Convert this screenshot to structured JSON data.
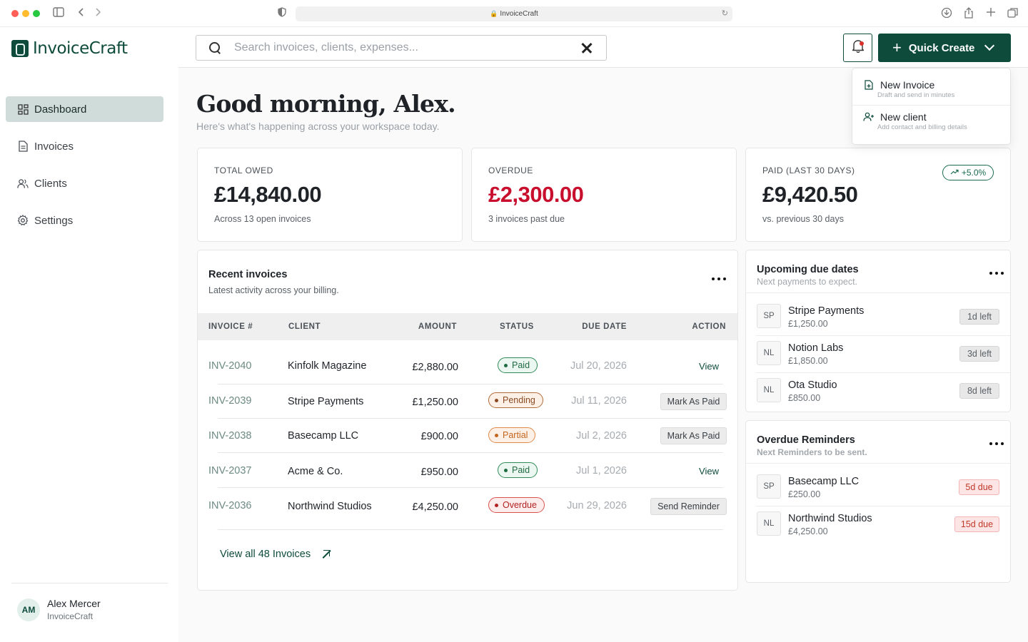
{
  "browser": {
    "url": "InvoiceCraft"
  },
  "app": {
    "name": "InvoiceCraft"
  },
  "sidebar": {
    "items": [
      {
        "label": "Dashboard",
        "icon": "dashboard-icon"
      },
      {
        "label": "Invoices",
        "icon": "document-icon"
      },
      {
        "label": "Clients",
        "icon": "users-icon"
      },
      {
        "label": "Settings",
        "icon": "gear-icon"
      }
    ],
    "active": "Dashboard",
    "user": {
      "initials": "AM",
      "name": "Alex Mercer",
      "org": "InvoiceCraft"
    }
  },
  "topbar": {
    "search_placeholder": "Search invoices, clients, expenses...",
    "search_value": "",
    "quick_create_label": "Quick Create"
  },
  "quick_create_menu": [
    {
      "title": "New Invoice",
      "subtitle": "Draft and send in minutes",
      "icon": "file-plus-icon"
    },
    {
      "title": "New client",
      "subtitle": "Add contact and billing details",
      "icon": "user-plus-icon"
    }
  ],
  "greeting": {
    "title": "Good morning, Alex.",
    "subtitle": "Here's what's happening across your workspace today."
  },
  "stats": [
    {
      "label": "TOTAL OWED",
      "value": "£14,840.00",
      "sub": "Across 13 open invoices"
    },
    {
      "label": "OVERDUE",
      "value": "£2,300.00",
      "sub": "3 invoices past due"
    },
    {
      "label": "PAID (LAST 30 DAYS)",
      "value": "£9,420.50",
      "sub": "vs. previous 30 days",
      "trend": "+5.0%"
    }
  ],
  "recent": {
    "title": "Recent invoices",
    "subtitle": "Latest activity across your billing.",
    "columns": [
      "INVOICE #",
      "CLIENT",
      "AMOUNT",
      "STATUS",
      "DUE DATE",
      "ACTION"
    ],
    "rows": [
      {
        "id": "INV-2040",
        "client": "Kinfolk Magazine",
        "amount": "£2,880.00",
        "status": "Paid",
        "due": "Jul 20, 2026",
        "action": "View"
      },
      {
        "id": "INV-2039",
        "client": "Stripe Payments",
        "amount": "£1,250.00",
        "status": "Pending",
        "due": "Jul 11, 2026",
        "action": "Mark As Paid"
      },
      {
        "id": "INV-2038",
        "client": "Basecamp LLC",
        "amount": "£900.00",
        "status": "Partial",
        "due": "Jul 2, 2026",
        "action": "Mark As Paid"
      },
      {
        "id": "INV-2037",
        "client": "Acme & Co.",
        "amount": "£950.00",
        "status": "Paid",
        "due": "Jul 1, 2026",
        "action": "View"
      },
      {
        "id": "INV-2036",
        "client": "Northwind Studios",
        "amount": "£4,250.00",
        "status": "Overdue",
        "due": "Jun 29, 2026",
        "action": "Send Reminder"
      }
    ],
    "view_all": "View all 48 Invoices"
  },
  "upcoming": {
    "title": "Upcoming due dates",
    "subtitle": "Next payments to expect.",
    "items": [
      {
        "initials": "SP",
        "name": "Stripe Payments",
        "amount": "£1,250.00",
        "tag": "1d left"
      },
      {
        "initials": "NL",
        "name": "Notion Labs",
        "amount": "£1,850.00",
        "tag": "3d left"
      },
      {
        "initials": "NL",
        "name": "Ota Studio",
        "amount": "£850.00",
        "tag": "8d left"
      }
    ]
  },
  "reminders": {
    "title": "Overdue Reminders",
    "subtitle": "Next Reminders to be sent.",
    "items": [
      {
        "initials": "SP",
        "name": "Basecamp LLC",
        "amount": "£250.00",
        "tag": "5d due"
      },
      {
        "initials": "NL",
        "name": "Northwind Studios",
        "amount": "£4,250.00",
        "tag": "15d due"
      }
    ]
  },
  "colors": {
    "brand": "#0e4b3b",
    "overdue_red": "#c8102e",
    "active_nav": "#cfdcda"
  }
}
